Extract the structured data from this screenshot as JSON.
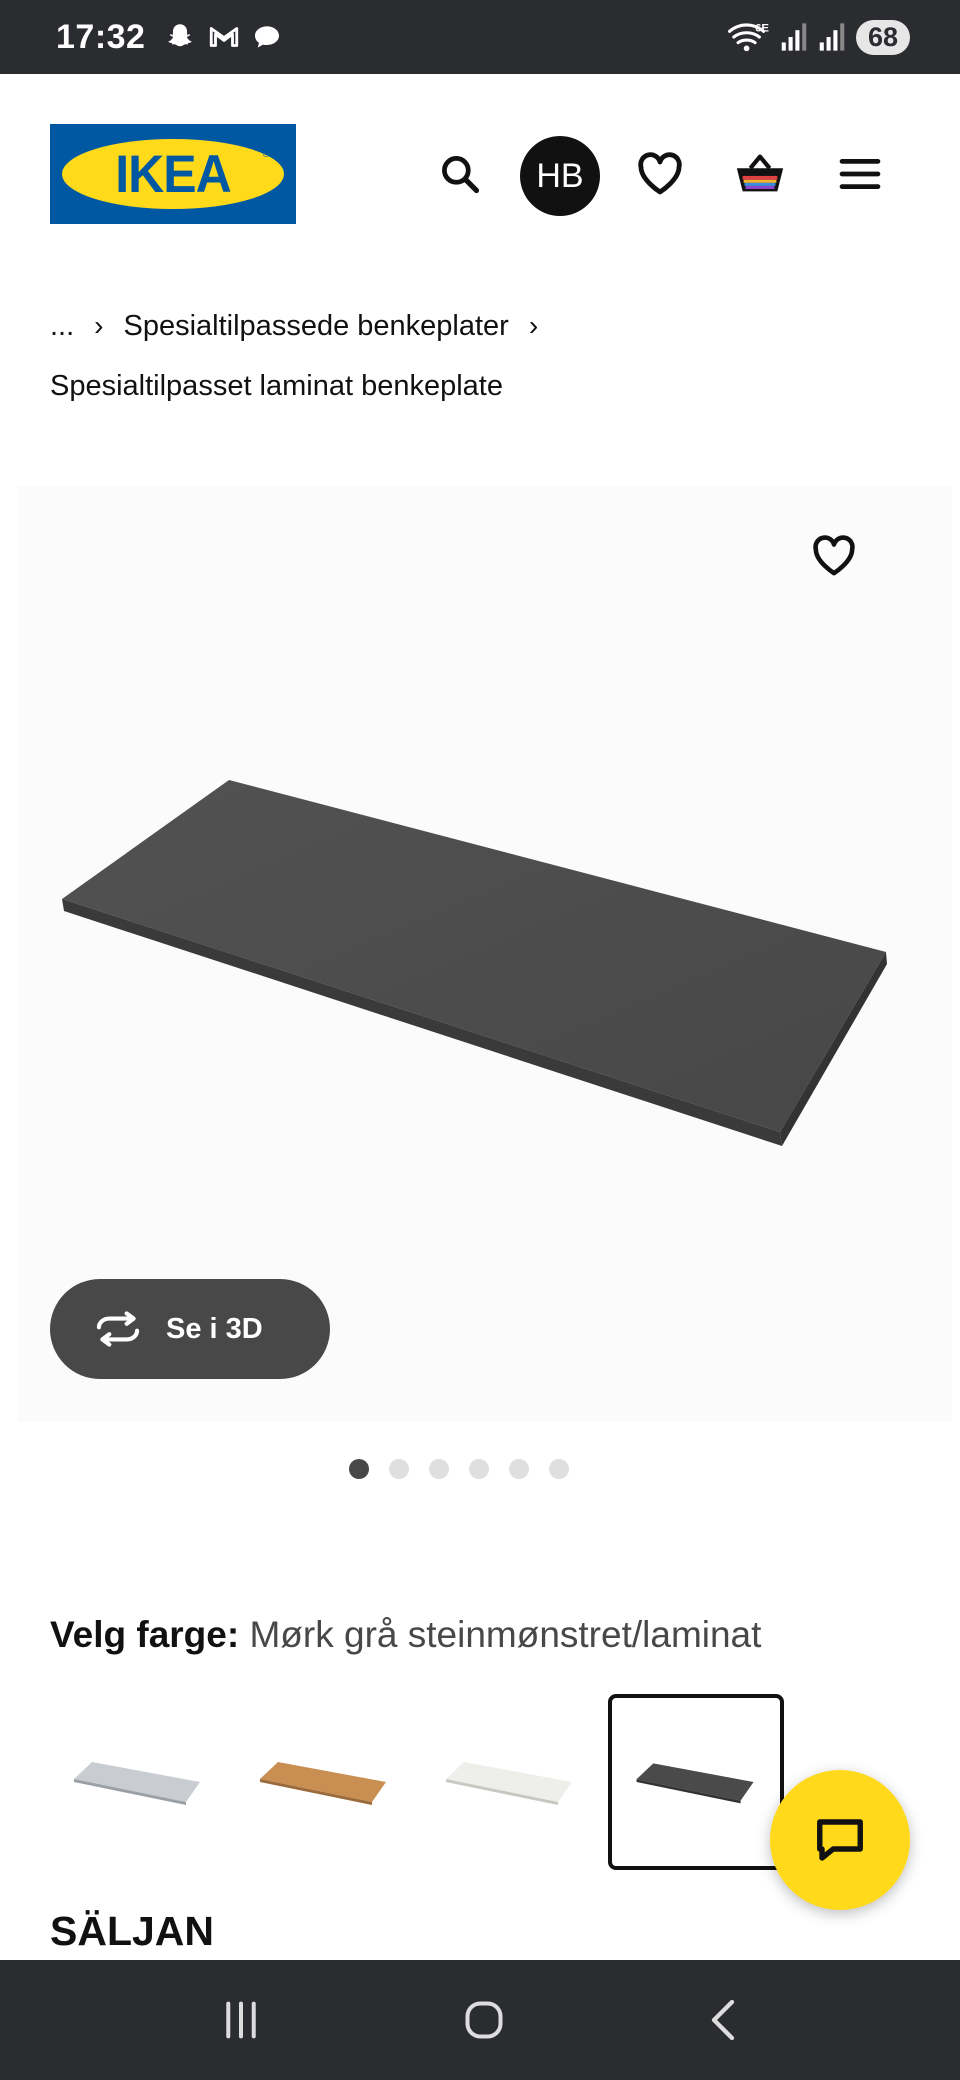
{
  "status_bar": {
    "time": "17:32",
    "network_label": "6E",
    "battery": "68"
  },
  "header": {
    "logo_text": "IKEA",
    "avatar_initials": "HB"
  },
  "breadcrumb": {
    "ellipsis": "...",
    "parent": "Spesialtilpassede benkeplater",
    "current": "Spesialtilpasset laminat benkeplate"
  },
  "gallery": {
    "see_3d_label": "Se i 3D",
    "image_count": 6,
    "active_index": 0
  },
  "color_picker": {
    "label": "Velg farge:",
    "selected_value": "Mørk grå steinmønstret/laminat",
    "swatches": [
      {
        "color": "#c9cdd2"
      },
      {
        "color": "#c98f52"
      },
      {
        "color": "#eeeeea"
      },
      {
        "color": "#4a4a4a"
      }
    ],
    "selected_index": 3
  },
  "product": {
    "name": "SÄLJAN"
  },
  "colors": {
    "ikea_blue": "#0058a3",
    "ikea_yellow": "#ffda1a",
    "dark": "#484848"
  }
}
